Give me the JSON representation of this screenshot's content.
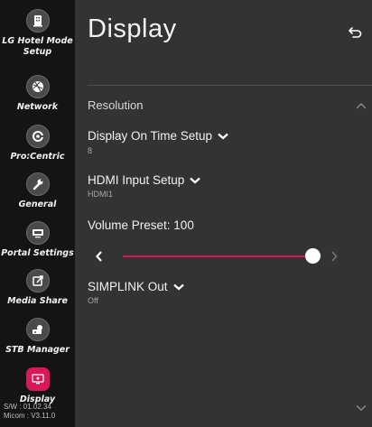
{
  "sidebar": {
    "items": [
      {
        "label": "LG Hotel Mode Setup",
        "icon": "hotel-icon"
      },
      {
        "label": "Network",
        "icon": "network-icon"
      },
      {
        "label": "Pro:Centric",
        "icon": "procentric-icon"
      },
      {
        "label": "General",
        "icon": "wrench-icon"
      },
      {
        "label": "Portal Settings",
        "icon": "portal-icon"
      },
      {
        "label": "Media Share",
        "icon": "media-share-icon"
      },
      {
        "label": "STB Manager",
        "icon": "stb-icon"
      },
      {
        "label": "Display",
        "icon": "display-icon",
        "active": true
      }
    ],
    "sw_line1": "S/W : 01.02.34",
    "sw_line2": "Micom : V3.11.0"
  },
  "header": {
    "title": "Display"
  },
  "section": {
    "title": "Resolution"
  },
  "rows": {
    "display_on_time": {
      "label": "Display On Time Setup",
      "value": "8"
    },
    "hdmi_input": {
      "label": "HDMI Input Setup",
      "value": "HDMI1"
    },
    "volume_preset": {
      "label": "Volume Preset: 100",
      "level": 1.0
    },
    "simplink": {
      "label": "SIMPLINK Out",
      "value": "Off"
    }
  },
  "colors": {
    "accent": "#d81857",
    "sidebar_bg": "#141414",
    "main_bg": "#333333"
  }
}
